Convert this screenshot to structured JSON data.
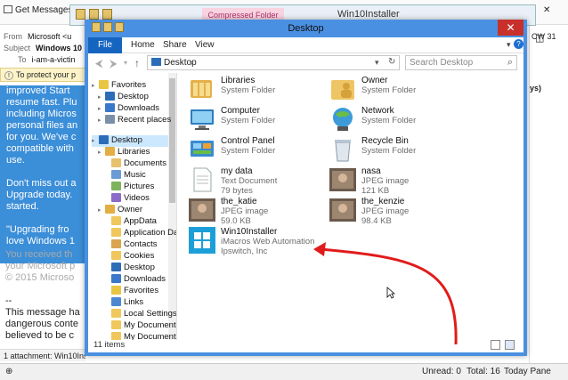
{
  "email": {
    "get_messages": "Get Messages",
    "from_label": "From",
    "from_value": "Microsoft <u",
    "subject_label": "Subject",
    "subject_value": "Windows 10",
    "to_label": "To",
    "to_value": "i-am-a-victin",
    "warning": "To protect your p",
    "body_paragraphs": [
      "improved Start\nresume fast. Plu\nincluding Micros\npersonal files an\nfor you. We've c\ncompatible with\nuse.",
      "Don't miss out a\nUpgrade today.\nstarted.",
      "\"Upgrading fro\nlove Windows 1"
    ],
    "grey_text": "You received th\nyour Microsoft p\n© 2015 Microso",
    "lower_text": "--\nThis message ha\ndangerous conte\nbelieved to be c",
    "attachment": "1 attachment: Win10Installer.zip",
    "status_unread": "Unread: 0",
    "status_total": "Total: 16",
    "today_pane": "Today Pane",
    "side_cw": "CW 31",
    "side_ys": "ys)"
  },
  "zip_window": {
    "ribbon_context": "Compressed Folder Tools",
    "title": "Win10Installer"
  },
  "explorer": {
    "title": "Desktop",
    "close": "✕",
    "tabs": {
      "file": "File",
      "home": "Home",
      "share": "Share",
      "view": "View"
    },
    "address": "Desktop",
    "address_chevron": "›",
    "search_placeholder": "Search Desktop",
    "nav": [
      {
        "label": "Favorites",
        "level": 0,
        "icon": "star-icon"
      },
      {
        "label": "Desktop",
        "level": 1,
        "icon": "desktop-icon"
      },
      {
        "label": "Downloads",
        "level": 1,
        "icon": "downloads-icon"
      },
      {
        "label": "Recent places",
        "level": 1,
        "icon": "recent-icon"
      },
      {
        "label": "Desktop",
        "level": 0,
        "icon": "desktop-icon",
        "selected": true
      },
      {
        "label": "Libraries",
        "level": 1,
        "icon": "libraries-icon"
      },
      {
        "label": "Documents",
        "level": 2,
        "icon": "documents-icon"
      },
      {
        "label": "Music",
        "level": 2,
        "icon": "music-icon"
      },
      {
        "label": "Pictures",
        "level": 2,
        "icon": "pictures-icon"
      },
      {
        "label": "Videos",
        "level": 2,
        "icon": "videos-icon"
      },
      {
        "label": "Owner",
        "level": 1,
        "icon": "user-icon"
      },
      {
        "label": "AppData",
        "level": 2,
        "icon": "folder-icon"
      },
      {
        "label": "Application Da",
        "level": 2,
        "icon": "folder-icon"
      },
      {
        "label": "Contacts",
        "level": 2,
        "icon": "contacts-icon"
      },
      {
        "label": "Cookies",
        "level": 2,
        "icon": "folder-icon"
      },
      {
        "label": "Desktop",
        "level": 2,
        "icon": "desktop-icon"
      },
      {
        "label": "Downloads",
        "level": 2,
        "icon": "downloads-icon"
      },
      {
        "label": "Favorites",
        "level": 2,
        "icon": "star-icon"
      },
      {
        "label": "Links",
        "level": 2,
        "icon": "links-icon"
      },
      {
        "label": "Local Settings",
        "level": 2,
        "icon": "folder-icon"
      },
      {
        "label": "My Documents",
        "level": 2,
        "icon": "folder-icon"
      },
      {
        "label": "My Documents",
        "level": 2,
        "icon": "folder-icon"
      }
    ],
    "files": [
      {
        "name": "Libraries",
        "type": "System Folder",
        "size": "",
        "icon": "libraries-icon"
      },
      {
        "name": "Owner",
        "type": "System Folder",
        "size": "",
        "icon": "user-folder-icon"
      },
      {
        "name": "Computer",
        "type": "System Folder",
        "size": "",
        "icon": "computer-icon"
      },
      {
        "name": "Network",
        "type": "System Folder",
        "size": "",
        "icon": "network-icon"
      },
      {
        "name": "Control Panel",
        "type": "System Folder",
        "size": "",
        "icon": "control-panel-icon"
      },
      {
        "name": "Recycle Bin",
        "type": "System Folder",
        "size": "",
        "icon": "recycle-bin-icon"
      },
      {
        "name": "my data",
        "type": "Text Document",
        "size": "79 bytes",
        "icon": "text-file-icon"
      },
      {
        "name": "nasa",
        "type": "JPEG image",
        "size": "121 KB",
        "icon": "image-thumb-icon"
      },
      {
        "name": "the_katie",
        "type": "JPEG image",
        "size": "59.0 KB",
        "icon": "image-thumb-icon"
      },
      {
        "name": "the_kenzie",
        "type": "JPEG image",
        "size": "98.4 KB",
        "icon": "image-thumb-icon"
      },
      {
        "name": "Win10Installer",
        "type": "iMacros Web Automation",
        "size": "Ipswitch, Inc",
        "icon": "windows-logo-icon"
      }
    ],
    "status_count": "11 items"
  },
  "colors": {
    "accent": "#4a90e2",
    "file_tab": "#1565c0",
    "close": "#c7302b",
    "annotation_arrow": "#e11b1b",
    "email_body": "#3b8ed8"
  }
}
